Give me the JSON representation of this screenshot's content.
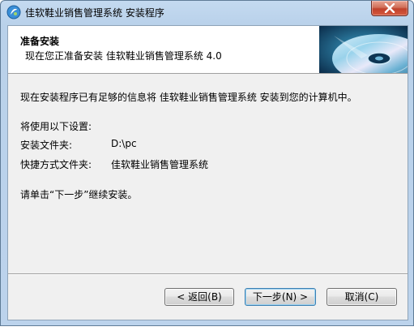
{
  "window": {
    "title": "佳软鞋业销售管理系统 安装程序"
  },
  "header": {
    "title": "准备安装",
    "subtitle": "现在您正准备安装 佳软鞋业销售管理系统 4.0"
  },
  "body": {
    "intro": "现在安装程序已有足够的信息将 佳软鞋业销售管理系统 安装到您的计算机中。",
    "settings_heading": "将使用以下设置:",
    "install_folder_label": "安装文件夹:",
    "install_folder_value": "D:\\pc",
    "shortcut_folder_label": "快捷方式文件夹:",
    "shortcut_folder_value": "佳软鞋业销售管理系统",
    "instruction": "请单击“下一步”继续安装。"
  },
  "buttons": {
    "back": "< 返回(B)",
    "next": "下一步(N) >",
    "cancel": "取消(C)"
  },
  "icons": {
    "app": "installer-icon",
    "close": "close-icon",
    "header_image": "cd-disc-image"
  }
}
